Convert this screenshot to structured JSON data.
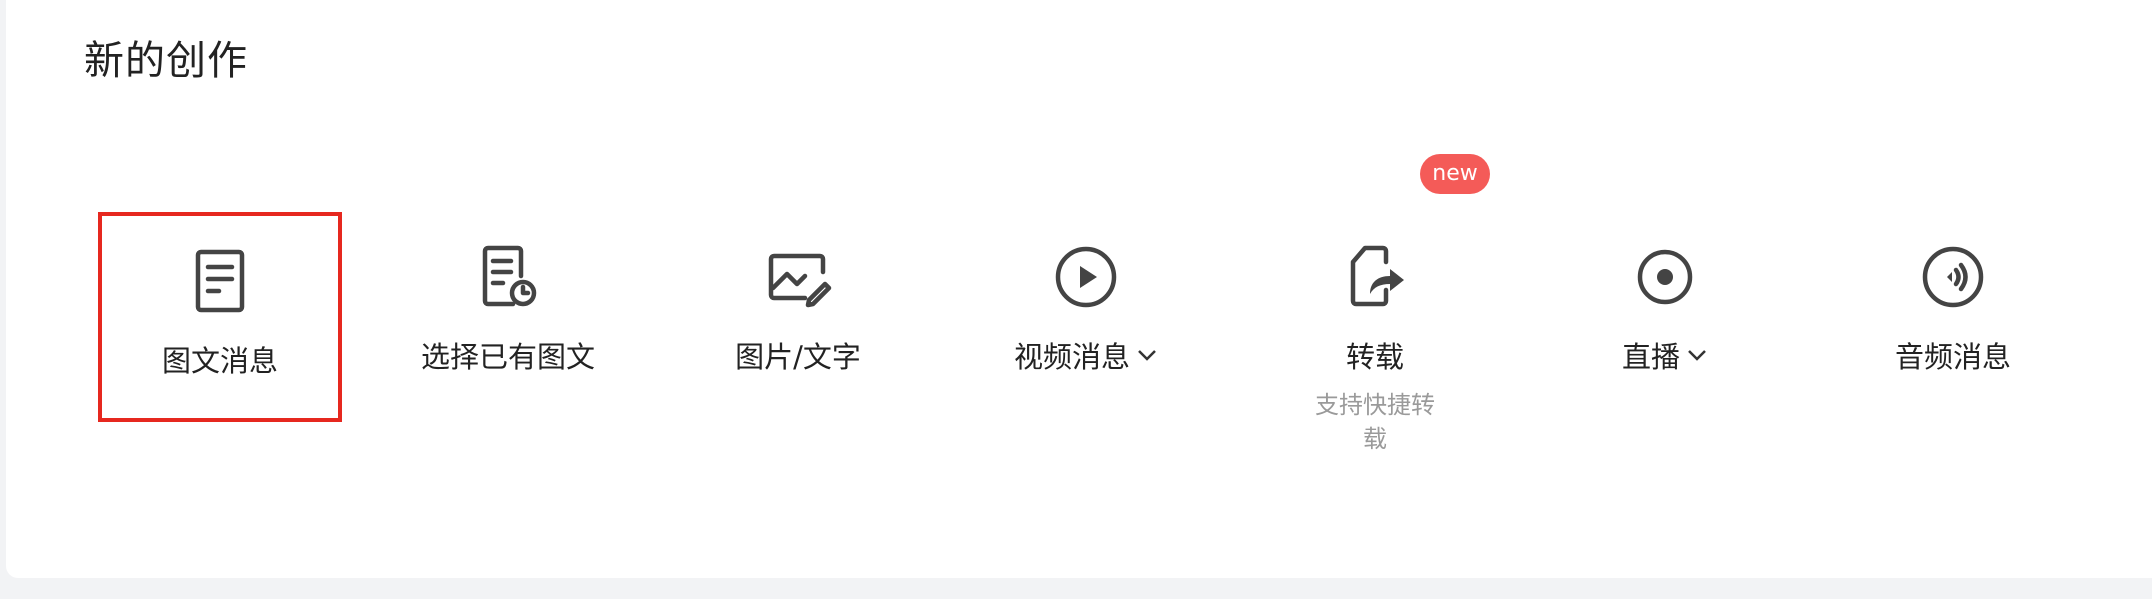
{
  "section_title": "新的创作",
  "items": [
    {
      "label": "图文消息",
      "icon": "article-icon",
      "selected": true
    },
    {
      "label": "选择已有图文",
      "icon": "article-history-icon"
    },
    {
      "label": "图片/文字",
      "icon": "image-text-icon"
    },
    {
      "label": "视频消息",
      "icon": "play-icon",
      "dropdown": true
    },
    {
      "label": "转载",
      "icon": "repost-icon",
      "badge": "new",
      "description": "支持快捷转载"
    },
    {
      "label": "直播",
      "icon": "live-icon",
      "dropdown": true
    },
    {
      "label": "音频消息",
      "icon": "audio-icon"
    }
  ],
  "colors": {
    "selection_border": "#e6281f",
    "badge_bg": "#f45b58",
    "icon_stroke": "#444444",
    "description_text": "#9a9a9a"
  }
}
